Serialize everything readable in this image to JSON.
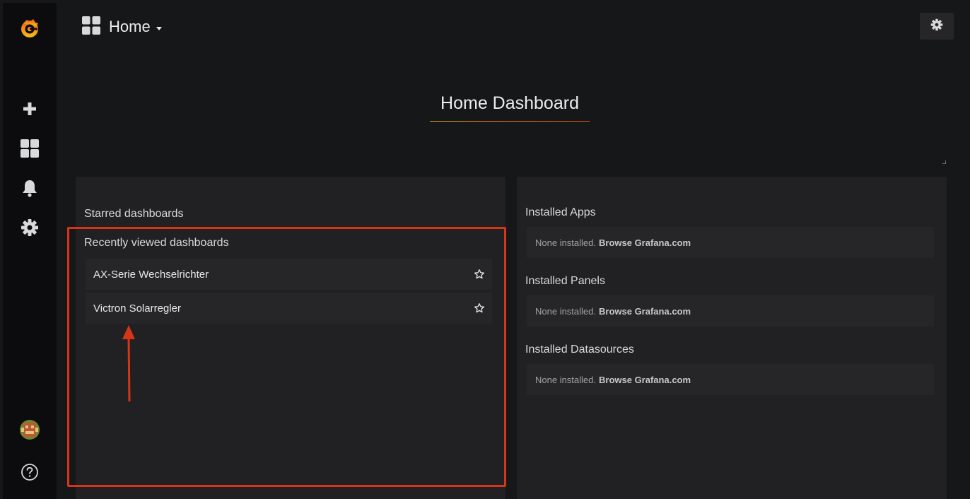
{
  "sidebar": {
    "logo": "grafana-logo-icon",
    "items": [
      {
        "name": "create",
        "icon": "plus-icon"
      },
      {
        "name": "dashboards",
        "icon": "dashboards-grid-icon"
      },
      {
        "name": "alerting",
        "icon": "bell-icon"
      },
      {
        "name": "configuration",
        "icon": "gear-icon"
      }
    ],
    "bottom": [
      {
        "name": "profile",
        "icon": "avatar-icon"
      },
      {
        "name": "help",
        "icon": "question-circle-icon"
      }
    ]
  },
  "navbar": {
    "dashboard_title": "Home",
    "settings_icon": "gear-icon"
  },
  "main": {
    "title": "Home Dashboard"
  },
  "left_panel": {
    "starred_heading": "Starred dashboards",
    "recent_heading": "Recently viewed dashboards",
    "recent": [
      {
        "label": "AX-Serie Wechselrichter"
      },
      {
        "label": "Victron Solarregler"
      }
    ]
  },
  "right_panel": {
    "sections": [
      {
        "heading": "Installed Apps",
        "none_text": "None installed.",
        "link": "Browse Grafana.com"
      },
      {
        "heading": "Installed Panels",
        "none_text": "None installed.",
        "link": "Browse Grafana.com"
      },
      {
        "heading": "Installed Datasources",
        "none_text": "None installed.",
        "link": "Browse Grafana.com"
      }
    ]
  },
  "colors": {
    "accent_orange": "#f2a20e",
    "annotation_red": "#d63617",
    "panel_bg": "#212124",
    "page_bg": "#161719"
  }
}
